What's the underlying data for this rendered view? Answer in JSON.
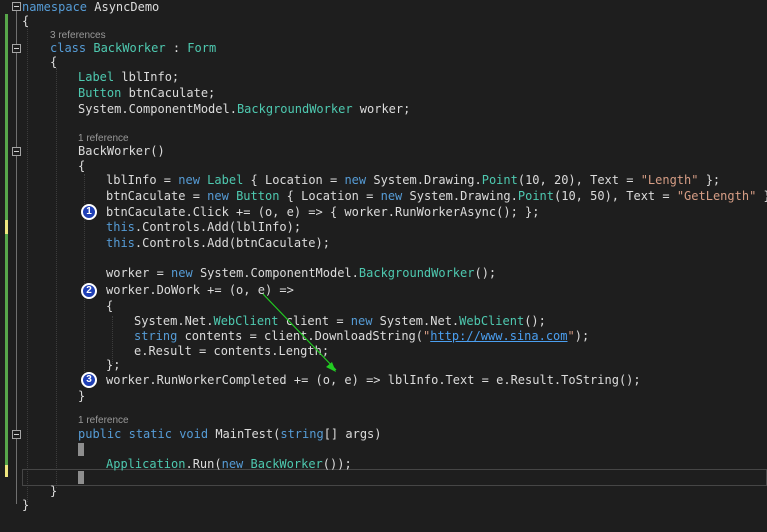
{
  "refs": {
    "class_refs": "3 references",
    "ctor_refs": "1 reference",
    "main_refs": "1 reference"
  },
  "markers": [
    "1",
    "2",
    "3"
  ],
  "code": {
    "ns_kw": "namespace",
    "ns_name": " AsyncDemo",
    "brace_open": "{",
    "brace_close": "}",
    "class_kw": "class",
    "class_name": "BackWorker",
    "class_sep": " : ",
    "class_base": "Form",
    "f1_type": "Label",
    "f1_rest": " lblInfo;",
    "f2_type": "Button",
    "f2_rest": " btnCaculate;",
    "f3_pre": "System.ComponentModel.",
    "f3_type": "BackgroundWorker",
    "f3_rest": " worker;",
    "ctor_name": "BackWorker()",
    "l1_a": "lblInfo = ",
    "l1_new": "new",
    "l1_type": "Label",
    "l1_b": " { Location = ",
    "l1_new2": "new",
    "l1_c": " System.Drawing.",
    "l1_type2": "Point",
    "l1_d": "(10, 20), Text = ",
    "l1_str": "\"Length\"",
    "l1_e": " };",
    "l2_a": "btnCaculate = ",
    "l2_new": "new",
    "l2_type": "Button",
    "l2_b": " { Location = ",
    "l2_new2": "new",
    "l2_c": " System.Drawing.",
    "l2_type2": "Point",
    "l2_d": "(10, 50), Text = ",
    "l2_str": "\"GetLength\"",
    "l2_e": " };",
    "l3": "btnCaculate.Click += (o, e) => { worker.RunWorkerAsync(); };",
    "l4_kw": "this",
    "l4_rest": ".Controls.Add(lblInfo);",
    "l5_kw": "this",
    "l5_rest": ".Controls.Add(btnCaculate);",
    "l6_a": "worker = ",
    "l6_new": "new",
    "l6_b": " System.ComponentModel.",
    "l6_type": "BackgroundWorker",
    "l6_c": "();",
    "l7": "worker.DoWork += (o, e) =>",
    "l8_a": "System.Net.",
    "l8_type": "WebClient",
    "l8_b": " client = ",
    "l8_new": "new",
    "l8_c": " System.Net.",
    "l8_type2": "WebClient",
    "l8_d": "();",
    "l9_kw": "string",
    "l9_a": " contents = client.DownloadString(",
    "l9_q1": "\"",
    "l9_url": "http://www.sina.com",
    "l9_q2": "\"",
    "l9_b": ");",
    "l10": "e.Result = contents.Length;",
    "l11": "};",
    "l12": "worker.RunWorkerCompleted += (o, e) => lblInfo.Text = e.Result.ToString();",
    "main_kw1": "public",
    "main_kw2": "static",
    "main_kw3": "void",
    "main_name": " MainTest(",
    "main_kw4": "string",
    "main_rest": "[] args)",
    "run_type": "Application",
    "run_a": ".Run(",
    "run_new": "new",
    "run_type2": "BackWorker",
    "run_b": "());"
  },
  "colors": {
    "background": "#1e1e1e",
    "keyword": "#569cd6",
    "type": "#4ec9b0",
    "string": "#d69d85",
    "arrow": "#22cc22",
    "marker": "#1f3fb5"
  }
}
